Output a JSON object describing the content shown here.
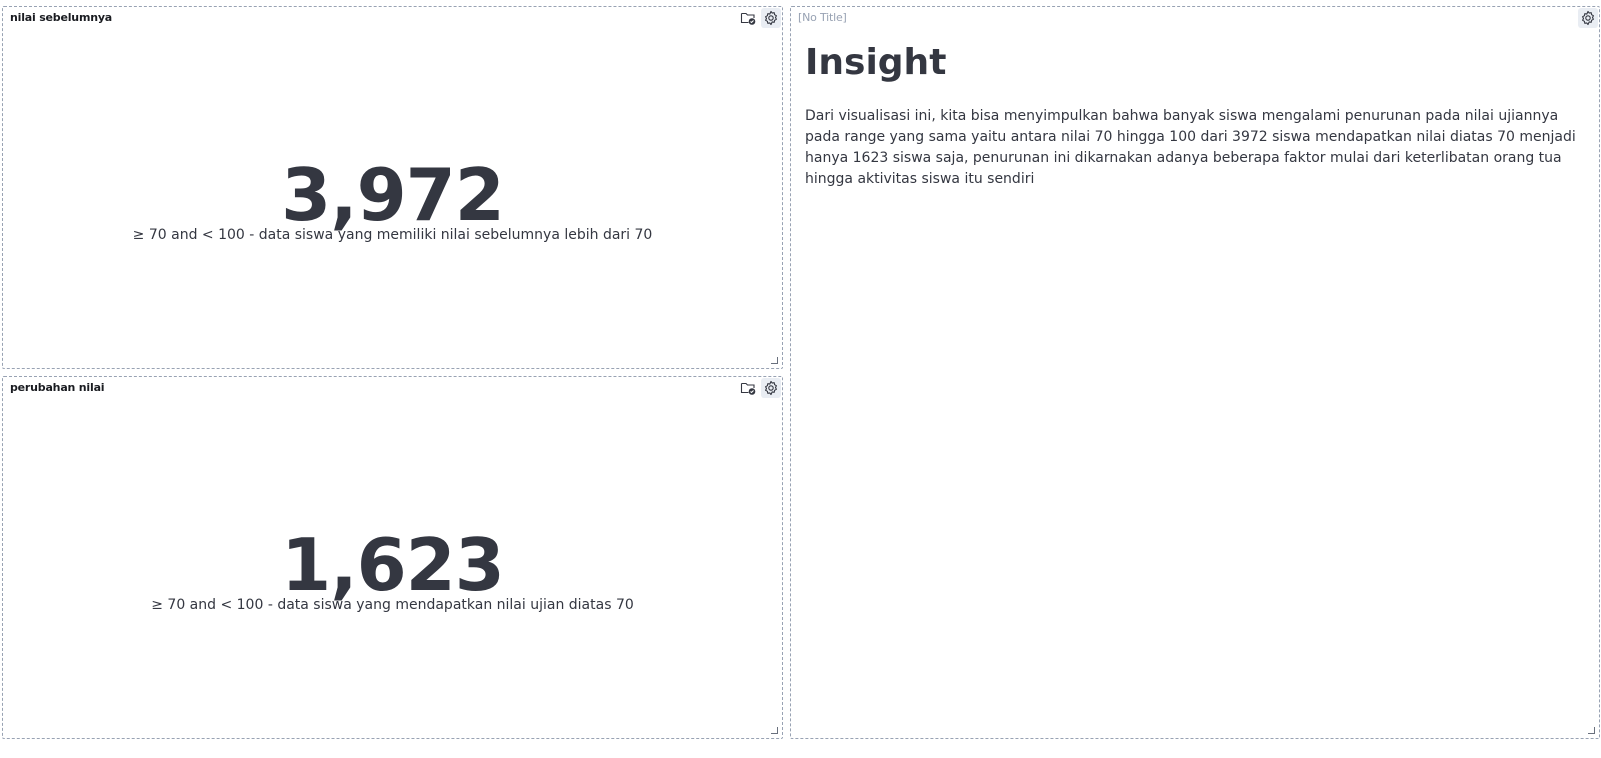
{
  "panels": {
    "top_left": {
      "title": "nilai sebelumnya",
      "value": "3,972",
      "label": "≥ 70 and < 100 - data siswa yang memiliki nilai sebelumnya lebih dari 70"
    },
    "bottom_left": {
      "title": "perubahan nilai",
      "value": "1,623",
      "label": "≥ 70 and < 100 - data siswa yang mendapatkan nilai ujian diatas 70"
    },
    "right": {
      "title": "[No Title]",
      "heading": "Insight",
      "paragraph": "Dari visualisasi ini, kita bisa menyimpulkan bahwa banyak siswa mengalami penurunan pada nilai ujiannya pada range yang sama yaitu antara nilai 70 hingga 100 dari 3972 siswa mendapatkan nilai diatas 70 menjadi hanya 1623 siswa saja, penurunan ini dikarnakan adanya beberapa faktor mulai dari keterlibatan orang tua hingga aktivitas siswa itu sendiri"
    }
  },
  "icons": {
    "folder": "folder-check-icon",
    "settings": "gear-icon",
    "resize": "resize-handle-icon"
  }
}
